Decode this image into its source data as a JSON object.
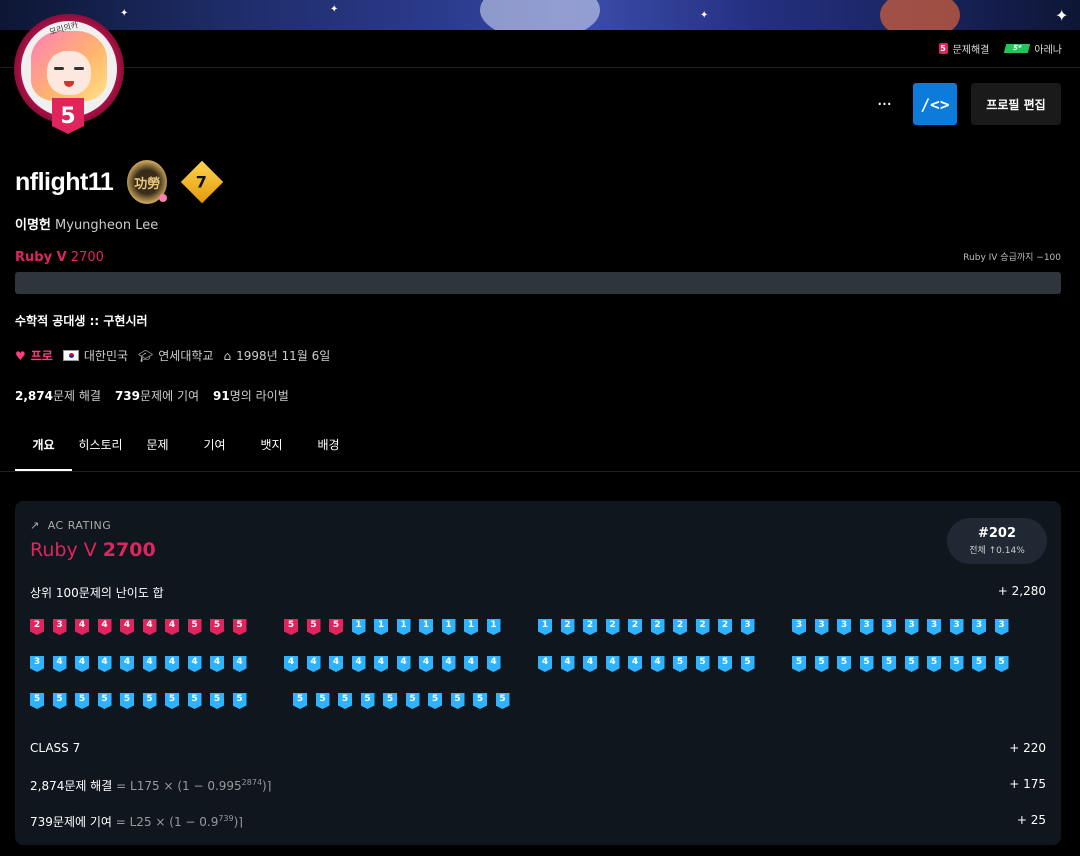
{
  "topnav": {
    "solved_tier": "5",
    "solved_label": "문제해결",
    "arena_badge": "5*",
    "arena_label": "아레나"
  },
  "avatar": {
    "tier": "5",
    "tag": "모리의카"
  },
  "actions": {
    "more_label": "···",
    "code_label": "/<>",
    "edit_label": "프로필 편집"
  },
  "profile": {
    "username": "nflight11",
    "medal_text": "功勞",
    "class_level": "7",
    "name_kr": "이명헌",
    "name_en": "Myungheon Lee",
    "rating_tier": "Ruby V",
    "rating_value": "2700",
    "next_label": "Ruby IV 승급까지 −100",
    "progress_fraction": 0.0,
    "bio": "수학적 공대생 :: 구현시러",
    "pro_label": "프로",
    "country": "대한민국",
    "school": "연세대학교",
    "birthday": "1998년 11월 6일",
    "solved_count": "2,874",
    "solved_suffix": "문제 해결",
    "contrib_count": "739",
    "contrib_suffix": "문제에 기여",
    "rival_count": "91",
    "rival_suffix": "명의 라이벌"
  },
  "tabs": [
    "개요",
    "히스토리",
    "문제",
    "기여",
    "뱃지",
    "배경"
  ],
  "card": {
    "head": "AC RATING",
    "rating_tier": "Ruby V",
    "rating_value": "2700",
    "rank": "#202",
    "rank_pct": "전체 ↑0.14%",
    "sum_label": "상위 100문제의 난이도 합",
    "sum_value": "+ 2,280",
    "tiers": [
      "r2",
      "r3",
      "r4",
      "r4",
      "r4",
      "r4",
      "r4",
      "r5",
      "r5",
      "r5",
      "r5",
      "r5",
      "r5",
      "d1",
      "d1",
      "d1",
      "d1",
      "d1",
      "d1",
      "d1",
      "d1",
      "d2",
      "d2",
      "d2",
      "d2",
      "d2",
      "d2",
      "d2",
      "d2",
      "d3",
      "d3",
      "d3",
      "d3",
      "d3",
      "d3",
      "d3",
      "d3",
      "d3",
      "d3",
      "d3",
      "d3",
      "d4",
      "d4",
      "d4",
      "d4",
      "d4",
      "d4",
      "d4",
      "d4",
      "d4",
      "d4",
      "d4",
      "d4",
      "d4",
      "d4",
      "d4",
      "d4",
      "d4",
      "d4",
      "d4",
      "d4",
      "d4",
      "d4",
      "d4",
      "d4",
      "d4",
      "d5",
      "d5",
      "d5",
      "d5",
      "d5",
      "d5",
      "d5",
      "d5",
      "d5",
      "d5",
      "d5",
      "d5",
      "d5",
      "d5",
      "d5",
      "d5",
      "d5",
      "d5",
      "d5",
      "d5",
      "d5",
      "d5",
      "d5",
      "d5",
      "d5",
      "d5",
      "d5",
      "d5",
      "d5",
      "d5",
      "d5",
      "d5",
      "d5",
      "d5"
    ],
    "class_label": "CLASS 7",
    "class_value": "+ 220",
    "solved_label": "2,874문제 해결",
    "solved_formula_pre": "= L175 × (1 − 0.995",
    "solved_formula_sup": "2874",
    "solved_formula_post": ")⌉",
    "solved_value": "+ 175",
    "contrib_label": "739문제에 기여",
    "contrib_formula_pre": "= L25 × (1 − 0.9",
    "contrib_formula_sup": "739",
    "contrib_formula_post": ")⌉",
    "contrib_value": "+ 25"
  }
}
